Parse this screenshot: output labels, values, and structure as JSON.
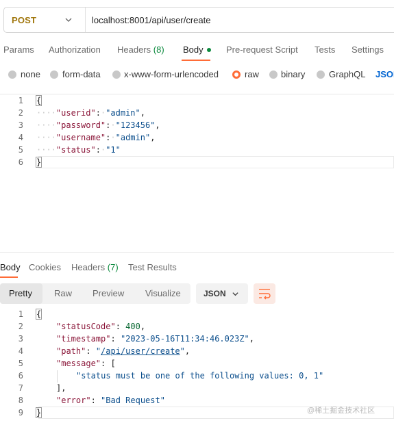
{
  "request": {
    "method": "POST",
    "url": "localhost:8001/api/user/create"
  },
  "request_tabs": [
    {
      "label": "Params"
    },
    {
      "label": "Authorization"
    },
    {
      "label": "Headers",
      "count": "(8)"
    },
    {
      "label": "Body"
    },
    {
      "label": "Pre-request Script"
    },
    {
      "label": "Tests"
    },
    {
      "label": "Settings"
    }
  ],
  "body_types": [
    {
      "label": "none"
    },
    {
      "label": "form-data"
    },
    {
      "label": "x-www-form-urlencoded"
    },
    {
      "label": "raw",
      "selected": true
    },
    {
      "label": "binary"
    },
    {
      "label": "GraphQL"
    }
  ],
  "body_format": "JSON",
  "request_body": {
    "line_numbers": [
      "1",
      "2",
      "3",
      "4",
      "5",
      "6"
    ],
    "open": "{",
    "close": "}",
    "fields": [
      {
        "key": "\"userid\"",
        "value": "\"admin\"",
        "sep": ","
      },
      {
        "key": "\"password\"",
        "value": "\"123456\"",
        "sep": ","
      },
      {
        "key": "\"username\"",
        "value": "\"admin\"",
        "sep": ","
      },
      {
        "key": "\"status\"",
        "value": "\"1\"",
        "sep": ""
      }
    ]
  },
  "response_tabs": [
    {
      "label": "Body"
    },
    {
      "label": "Cookies"
    },
    {
      "label": "Headers",
      "count": "(7)"
    },
    {
      "label": "Test Results"
    }
  ],
  "view_modes": [
    {
      "label": "Pretty"
    },
    {
      "label": "Raw"
    },
    {
      "label": "Preview"
    },
    {
      "label": "Visualize"
    }
  ],
  "response_format": "JSON",
  "response_body": {
    "line_numbers": [
      "1",
      "2",
      "3",
      "4",
      "5",
      "6",
      "7",
      "8",
      "9"
    ],
    "open": "{",
    "close": "}",
    "status_key": "\"statusCode\"",
    "status_value": "400",
    "timestamp_key": "\"timestamp\"",
    "timestamp_value": "\"2023-05-16T11:34:46.023Z\"",
    "path_key": "\"path\"",
    "path_value": "/api/user/create",
    "message_key": "\"message\"",
    "message_open": "[",
    "message_item": "\"status must be one of the following values: 0, 1\"",
    "message_close": "],",
    "error_key": "\"error\"",
    "error_value": "\"Bad Request\""
  },
  "watermark": "@稀土掘金技术社区",
  "colors": {
    "accent": "#ff6c37",
    "method": "#a0760c",
    "count": "#0c8a3e",
    "link": "#0265d2"
  }
}
